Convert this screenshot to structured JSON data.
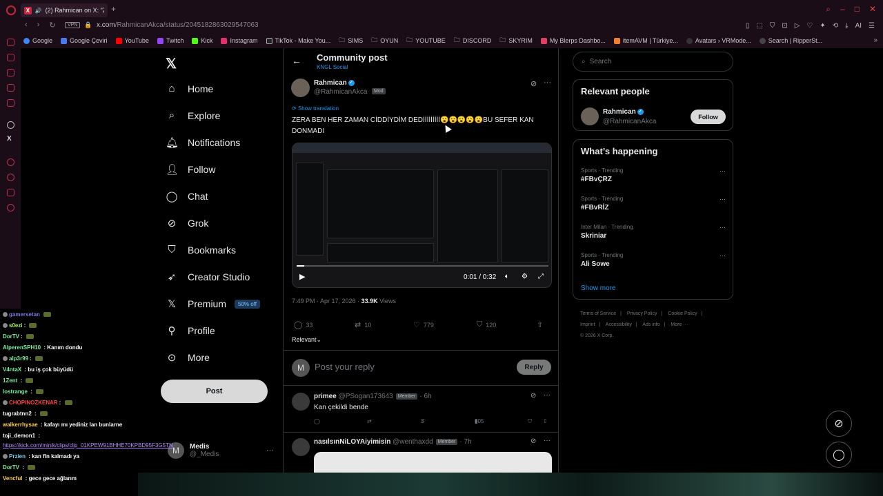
{
  "browser": {
    "tab_title": "(2) Rahmican on X: \"Z",
    "url_host": "x.com",
    "url_path": "/RahmicanAkca/status/2045182863029547063",
    "vpn_label": "VPN",
    "bookmarks": [
      "Google",
      "Google Çeviri",
      "YouTube",
      "Twitch",
      "Kick",
      "Instagram",
      "TikTok - Make You...",
      "SIMS",
      "OYUN",
      "YOUTUBE",
      "DISCORD",
      "SKYRIM",
      "My Blerps Dashbo...",
      "itemAVM | Türkiye...",
      "Avatars › VRMode...",
      "Search | RipperSt..."
    ]
  },
  "nav": {
    "items": [
      {
        "label": "Home",
        "icon": "home-icon"
      },
      {
        "label": "Explore",
        "icon": "search-icon"
      },
      {
        "label": "Notifications",
        "icon": "bell-icon"
      },
      {
        "label": "Follow",
        "icon": "follow-icon"
      },
      {
        "label": "Chat",
        "icon": "chat-icon"
      },
      {
        "label": "Grok",
        "icon": "grok-icon"
      },
      {
        "label": "Bookmarks",
        "icon": "bookmark-icon"
      },
      {
        "label": "Creator Studio",
        "icon": "rocket-icon"
      },
      {
        "label": "Premium",
        "icon": "x-icon"
      },
      {
        "label": "Profile",
        "icon": "person-icon"
      },
      {
        "label": "More",
        "icon": "more-icon"
      }
    ],
    "premium_badge": "50% off",
    "post_button": "Post",
    "account": {
      "avatar_letter": "M",
      "name": "Medis",
      "handle": "@_Medis"
    }
  },
  "post": {
    "header_title": "Community post",
    "header_sub": "KNGL Social",
    "author_name": "Rahmican",
    "author_handle": "@RahmicanAkca",
    "author_badge": "Mod",
    "show_translation": "Show translation",
    "text": "ZERA BEN HER ZAMAN CİDDİYDİM DEDİİİİİİİİİ😮😮😮😮😮BU SEFER KAN DONMADI",
    "video_time": "0:01 / 0:32",
    "video_progress": 0.03,
    "timestamp": "7:49 PM · Apr 17, 2026 · ",
    "views_count": "33.9K",
    "views_label": " Views",
    "replies": "33",
    "reposts": "10",
    "likes": "779",
    "bookmarks": "120",
    "sort_label": "Relevant",
    "reply_avatar_letter": "M",
    "reply_placeholder": "Post your reply",
    "reply_button": "Reply"
  },
  "comments": [
    {
      "name": "primee",
      "handle": "@PSogan173643",
      "badge": "Member",
      "time": "· 6h",
      "text": "Kan çekildi bende",
      "likes": "3",
      "views": "805"
    },
    {
      "name": "nasılsınNiLOYAiyimisin",
      "handle": "@wenthaxdd",
      "badge": "Member",
      "time": "· 7h",
      "text": ""
    }
  ],
  "sidebar": {
    "search_placeholder": "Search",
    "relevant_title": "Relevant people",
    "relevant_name": "Rahmican",
    "relevant_handle": "@RahmicanAkca",
    "follow_button": "Follow",
    "happening_title": "What’s happening",
    "trends": [
      {
        "category": "Sports · Trending",
        "name": "#FBvÇRZ"
      },
      {
        "category": "Sports · Trending",
        "name": "#FBvRİZ"
      },
      {
        "category": "Inter Milan · Trending",
        "name": "Skriniar"
      },
      {
        "category": "Sports · Trending",
        "name": "Ali Sowe"
      }
    ],
    "show_more": "Show more",
    "footer": [
      "Terms of Service",
      "|",
      "Privacy Policy",
      "|",
      "Cookie Policy",
      "|",
      "Imprint",
      "|",
      "Accessibility",
      "|",
      "Ads info",
      "|",
      "More ···",
      "© 2026 X Corp."
    ]
  },
  "stream_chat": [
    {
      "user": "gamersetan",
      "msg": "",
      "color": "#7a7adf"
    },
    {
      "user": "s0ezi",
      "msg": "",
      "color": "#a7f35a"
    },
    {
      "user": "DorTV",
      "msg": "",
      "color": "#7af0a0"
    },
    {
      "user": "AlperenSPH10",
      "msg": "Kanım dondu",
      "color": "#7af0a0"
    },
    {
      "user": "alp3r99",
      "msg": "",
      "color": "#7af0a0"
    },
    {
      "user": "V4ntaX",
      "msg": "bu iş çok büyüdü",
      "color": "#7af0a0"
    },
    {
      "user": "1Zent",
      "msg": "",
      "color": "#7af0a0"
    },
    {
      "user": "lostrange",
      "msg": "",
      "color": "#7af0a0"
    },
    {
      "user": "CHOPINOZKENAR",
      "msg": "",
      "color": "#ff4040"
    },
    {
      "user": "tugrabtnn2",
      "msg": "",
      "color": "#ffffff"
    },
    {
      "user": "walkerrhysae",
      "msg": "kafayı mı yediniz lan bunlarne",
      "color": "#ffd04a"
    },
    {
      "user": "toji_demon1",
      "msg": "",
      "color": "#ffffff"
    },
    {
      "user": "",
      "msg": "https://kick.com/minik/clips/clip_01KPEW91BHHE70KPBD95F3G5TN",
      "color": "#b58cff"
    },
    {
      "user": "Przien",
      "msg": "kan fln kalmadı ya",
      "color": "#7ad0f0"
    },
    {
      "user": "DorTV",
      "msg": "",
      "color": "#7af0a0"
    },
    {
      "user": "Vencful",
      "msg": "gece gece ağlarım",
      "color": "#ffd04a"
    }
  ]
}
